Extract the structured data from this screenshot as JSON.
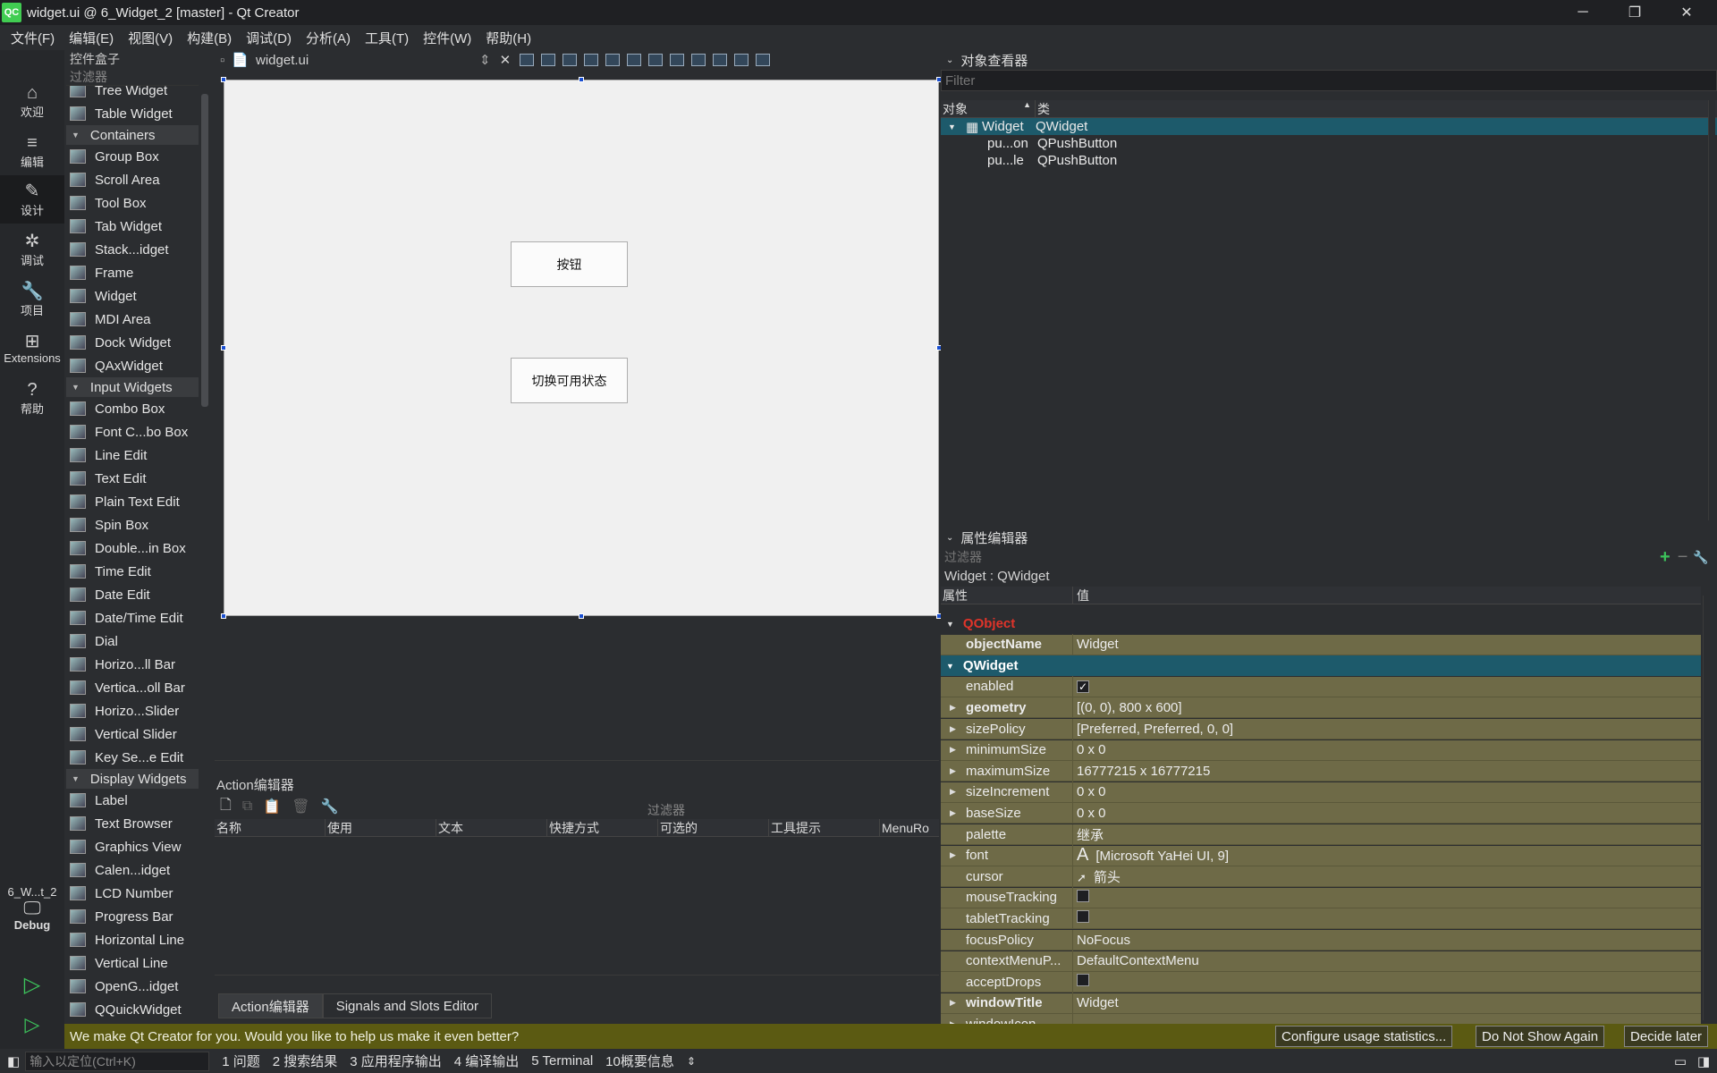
{
  "window": {
    "title": "widget.ui @ 6_Widget_2 [master] - Qt Creator",
    "app_icon": "QC"
  },
  "menu": [
    "文件(F)",
    "编辑(E)",
    "视图(V)",
    "构建(B)",
    "调试(D)",
    "分析(A)",
    "工具(T)",
    "控件(W)",
    "帮助(H)"
  ],
  "modes": [
    {
      "label": "欢迎",
      "icon": "⌂"
    },
    {
      "label": "编辑",
      "icon": "≡"
    },
    {
      "label": "设计",
      "icon": "✎"
    },
    {
      "label": "调试",
      "icon": "✲"
    },
    {
      "label": "项目",
      "icon": "🔧"
    },
    {
      "label": "Extensions",
      "icon": "⊞"
    },
    {
      "label": "帮助",
      "icon": "?"
    }
  ],
  "kit": {
    "project": "6_W...t_2",
    "config": "Debug"
  },
  "toolbox": {
    "title": "控件盒子",
    "filter": "过滤器",
    "items": [
      {
        "label": "Tree Widget"
      },
      {
        "label": "Table Widget"
      },
      {
        "label": "Containers",
        "category": true
      },
      {
        "label": "Group Box"
      },
      {
        "label": "Scroll Area"
      },
      {
        "label": "Tool Box"
      },
      {
        "label": "Tab Widget"
      },
      {
        "label": "Stack...idget"
      },
      {
        "label": "Frame"
      },
      {
        "label": "Widget"
      },
      {
        "label": "MDI Area"
      },
      {
        "label": "Dock Widget"
      },
      {
        "label": "QAxWidget"
      },
      {
        "label": "Input Widgets",
        "category": true
      },
      {
        "label": "Combo Box"
      },
      {
        "label": "Font C...bo Box"
      },
      {
        "label": "Line Edit"
      },
      {
        "label": "Text Edit"
      },
      {
        "label": "Plain Text Edit"
      },
      {
        "label": "Spin Box"
      },
      {
        "label": "Double...in Box"
      },
      {
        "label": "Time Edit"
      },
      {
        "label": "Date Edit"
      },
      {
        "label": "Date/Time Edit"
      },
      {
        "label": "Dial"
      },
      {
        "label": "Horizo...ll Bar"
      },
      {
        "label": "Vertica...oll Bar"
      },
      {
        "label": "Horizo...Slider"
      },
      {
        "label": "Vertical Slider"
      },
      {
        "label": "Key Se...e Edit"
      },
      {
        "label": "Display Widgets",
        "category": true
      },
      {
        "label": "Label"
      },
      {
        "label": "Text Browser"
      },
      {
        "label": "Graphics View"
      },
      {
        "label": "Calen...idget"
      },
      {
        "label": "LCD Number"
      },
      {
        "label": "Progress Bar"
      },
      {
        "label": "Horizontal Line"
      },
      {
        "label": "Vertical Line"
      },
      {
        "label": "OpenG...idget"
      },
      {
        "label": "QQuickWidget"
      }
    ]
  },
  "editor": {
    "file_tab": "widget.ui"
  },
  "form": {
    "button1": "按钮",
    "button2": "切换可用状态"
  },
  "action_editor": {
    "title": "Action编辑器",
    "filter": "过滤器",
    "columns": [
      "名称",
      "使用",
      "文本",
      "快捷方式",
      "可选的",
      "工具提示",
      "MenuRo"
    ]
  },
  "bottom_tabs": [
    "Action编辑器",
    "Signals and Slots Editor"
  ],
  "object_inspector": {
    "title": "对象查看器",
    "filter_placeholder": "Filter",
    "col_object": "对象",
    "col_class": "类",
    "rows": [
      {
        "name": "Widget",
        "class": "QWidget"
      },
      {
        "name": "pu...on",
        "class": "QPushButton"
      },
      {
        "name": "pu...le",
        "class": "QPushButton"
      }
    ]
  },
  "property_editor": {
    "title": "属性编辑器",
    "filter": "过滤器",
    "subject": "Widget : QWidget",
    "col_prop": "属性",
    "col_value": "值",
    "cat_qobject": "QObject",
    "cat_qwidget": "QWidget",
    "rows": [
      {
        "name": "objectName",
        "value": "Widget",
        "bold": true
      },
      {
        "name": "enabled",
        "value": "",
        "checkbox": true,
        "checked": true
      },
      {
        "name": "geometry",
        "value": "[(0, 0), 800 x 600]",
        "bold": true,
        "expandable": true
      },
      {
        "name": "sizePolicy",
        "value": "[Preferred, Preferred, 0, 0]",
        "expandable": true
      },
      {
        "name": "minimumSize",
        "value": "0 x 0",
        "expandable": true
      },
      {
        "name": "maximumSize",
        "value": "16777215 x 16777215",
        "expandable": true
      },
      {
        "name": "sizeIncrement",
        "value": "0 x 0",
        "expandable": true
      },
      {
        "name": "baseSize",
        "value": "0 x 0",
        "expandable": true
      },
      {
        "name": "palette",
        "value": "继承"
      },
      {
        "name": "font",
        "value": "[Microsoft YaHei UI, 9]",
        "expandable": true,
        "prefix": "A"
      },
      {
        "name": "cursor",
        "value": "箭头",
        "prefix": "➚"
      },
      {
        "name": "mouseTracking",
        "value": "",
        "checkbox": true,
        "checked": false
      },
      {
        "name": "tabletTracking",
        "value": "",
        "checkbox": true,
        "checked": false
      },
      {
        "name": "focusPolicy",
        "value": "NoFocus"
      },
      {
        "name": "contextMenuP...",
        "value": "DefaultContextMenu"
      },
      {
        "name": "acceptDrops",
        "value": "",
        "checkbox": true,
        "checked": false
      },
      {
        "name": "windowTitle",
        "value": "Widget",
        "bold": true,
        "expandable": true
      },
      {
        "name": "windowIcon",
        "value": "",
        "expandable": true
      }
    ]
  },
  "notification": {
    "text": "We make Qt Creator for you. Would you like to help us make it even better?",
    "btn_configure": "Configure usage statistics...",
    "btn_dont_show": "Do Not Show Again",
    "btn_later": "Decide later"
  },
  "statusbar": {
    "locator_placeholder": "输入以定位(Ctrl+K)",
    "panes": [
      "1 问题",
      "2 搜索结果",
      "3 应用程序输出",
      "4 编译输出",
      "5 Terminal",
      "10概要信息"
    ]
  }
}
